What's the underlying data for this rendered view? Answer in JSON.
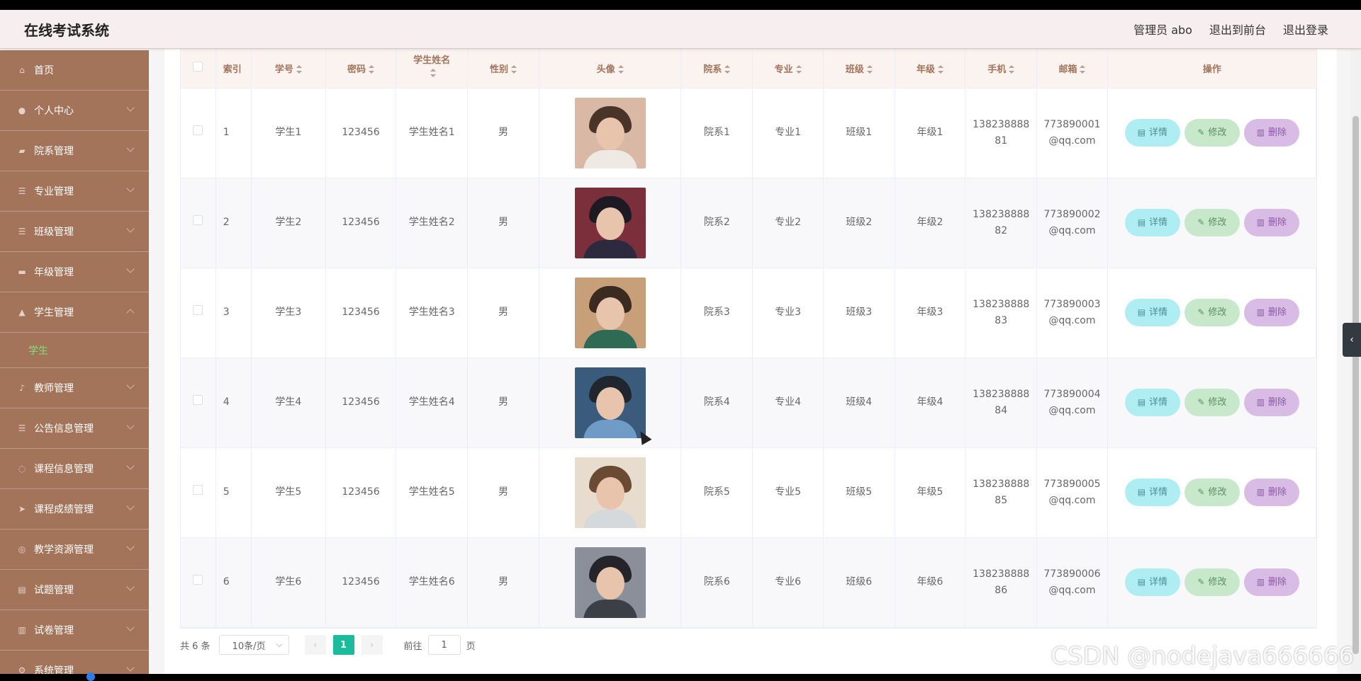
{
  "header": {
    "title": "在线考试系统",
    "admin_label": "管理员 abo",
    "front_label": "退出到前台",
    "logout_label": "退出登录"
  },
  "sidebar": {
    "items": [
      {
        "label": "首页",
        "icon": "home-icon",
        "glyph": "⌂"
      },
      {
        "label": "个人中心",
        "icon": "user-icon",
        "glyph": "●"
      },
      {
        "label": "院系管理",
        "icon": "building-icon",
        "glyph": "▰"
      },
      {
        "label": "专业管理",
        "icon": "sliders-icon",
        "glyph": "☰"
      },
      {
        "label": "班级管理",
        "icon": "list-icon",
        "glyph": "☰"
      },
      {
        "label": "年级管理",
        "icon": "monitor-icon",
        "glyph": "▬"
      },
      {
        "label": "学生管理",
        "icon": "graduate-icon",
        "glyph": "▲"
      },
      {
        "label": "教师管理",
        "icon": "microphone-icon",
        "glyph": "♪"
      },
      {
        "label": "公告信息管理",
        "icon": "menu-icon",
        "glyph": "☰"
      },
      {
        "label": "课程信息管理",
        "icon": "power-icon",
        "glyph": "◌"
      },
      {
        "label": "课程成绩管理",
        "icon": "send-icon",
        "glyph": "➤"
      },
      {
        "label": "教学资源管理",
        "icon": "globe-icon",
        "glyph": "◎"
      },
      {
        "label": "试题管理",
        "icon": "doc-icon",
        "glyph": "▤"
      },
      {
        "label": "试卷管理",
        "icon": "chart-icon",
        "glyph": "▥"
      },
      {
        "label": "系统管理",
        "icon": "gear-icon",
        "glyph": "⚙"
      }
    ],
    "sub_item": "学生"
  },
  "table": {
    "headers": {
      "index": "索引",
      "student_no": "学号",
      "password": "密码",
      "student_name": "学生姓名",
      "gender": "性别",
      "avatar": "头像",
      "department": "院系",
      "major": "专业",
      "class": "班级",
      "grade": "年级",
      "phone": "手机",
      "email": "邮箱",
      "actions": "操作"
    },
    "rows": [
      {
        "index": "1",
        "student_no": "学生1",
        "password": "123456",
        "name": "学生姓名1",
        "gender": "男",
        "department": "院系1",
        "major": "专业1",
        "class": "班级1",
        "grade": "年级1",
        "phone_a": "138238888",
        "phone_b": "81",
        "email_a": "773890001",
        "email_b": "@qq.com"
      },
      {
        "index": "2",
        "student_no": "学生2",
        "password": "123456",
        "name": "学生姓名2",
        "gender": "男",
        "department": "院系2",
        "major": "专业2",
        "class": "班级2",
        "grade": "年级2",
        "phone_a": "138238888",
        "phone_b": "82",
        "email_a": "773890002",
        "email_b": "@qq.com"
      },
      {
        "index": "3",
        "student_no": "学生3",
        "password": "123456",
        "name": "学生姓名3",
        "gender": "男",
        "department": "院系3",
        "major": "专业3",
        "class": "班级3",
        "grade": "年级3",
        "phone_a": "138238888",
        "phone_b": "83",
        "email_a": "773890003",
        "email_b": "@qq.com"
      },
      {
        "index": "4",
        "student_no": "学生4",
        "password": "123456",
        "name": "学生姓名4",
        "gender": "男",
        "department": "院系4",
        "major": "专业4",
        "class": "班级4",
        "grade": "年级4",
        "phone_a": "138238888",
        "phone_b": "84",
        "email_a": "773890004",
        "email_b": "@qq.com"
      },
      {
        "index": "5",
        "student_no": "学生5",
        "password": "123456",
        "name": "学生姓名5",
        "gender": "男",
        "department": "院系5",
        "major": "专业5",
        "class": "班级5",
        "grade": "年级5",
        "phone_a": "138238888",
        "phone_b": "85",
        "email_a": "773890005",
        "email_b": "@qq.com"
      },
      {
        "index": "6",
        "student_no": "学生6",
        "password": "123456",
        "name": "学生姓名6",
        "gender": "男",
        "department": "院系6",
        "major": "专业6",
        "class": "班级6",
        "grade": "年级6",
        "phone_a": "138238888",
        "phone_b": "86",
        "email_a": "773890006",
        "email_b": "@qq.com"
      }
    ],
    "buttons": {
      "detail": "详情",
      "edit": "修改",
      "delete": "删除"
    },
    "avatar_colors": [
      {
        "bg": "#d9b8a6",
        "hair": "#4a342a",
        "body": "#efe9e4"
      },
      {
        "bg": "#7a2f3b",
        "hair": "#1e1a24",
        "body": "#2d2a40"
      },
      {
        "bg": "#c7a07a",
        "hair": "#3a2a20",
        "body": "#2f6a55"
      },
      {
        "bg": "#3b5b7c",
        "hair": "#20262e",
        "body": "#6f9bc7"
      },
      {
        "bg": "#e7dccd",
        "hair": "#6b4a33",
        "body": "#d5d9dc"
      },
      {
        "bg": "#8a8f9a",
        "hair": "#25242a",
        "body": "#3d3f47"
      }
    ]
  },
  "pagination": {
    "total": "共 6 条",
    "page_size": "10条/页",
    "current_page": "1",
    "goto_prefix": "前往",
    "goto_value": "1",
    "goto_suffix": "页"
  },
  "watermark": "CSDN @nodejava666666",
  "colors": {
    "sidebar": "#a3735a",
    "header": "#f6eeef",
    "accent": "#1abc9c",
    "submenu_active": "#7fe07a"
  }
}
